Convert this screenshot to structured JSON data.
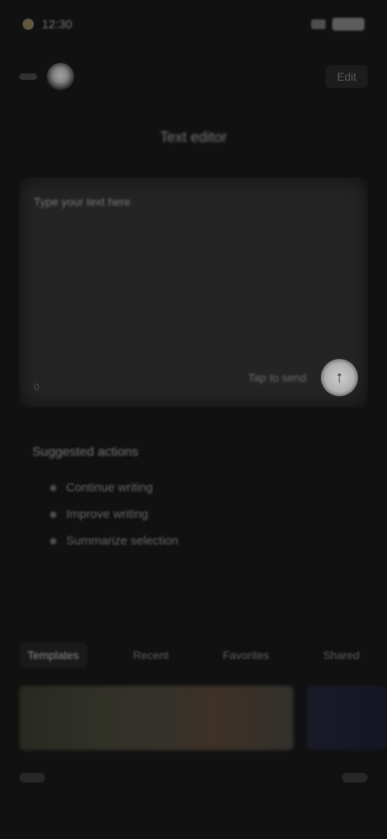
{
  "status": {
    "time": "12:30"
  },
  "header": {
    "action_label": "Edit"
  },
  "title": "Text editor",
  "card": {
    "label": "Type your text here",
    "corner": "0",
    "bottom_text": "Tap to send"
  },
  "options": {
    "title": "Suggested actions",
    "items": [
      "Continue writing",
      "Improve writing",
      "Summarize selection"
    ]
  },
  "tabs": [
    {
      "label": "Templates",
      "active": true
    },
    {
      "label": "Recent",
      "active": false
    },
    {
      "label": "Favorites",
      "active": false
    },
    {
      "label": "Shared",
      "active": false
    }
  ],
  "icons": {
    "fab": "arrow-up-icon",
    "brand": "app-logo-icon"
  },
  "colors": {
    "background": "#141414",
    "card": "#2b2b2b"
  }
}
